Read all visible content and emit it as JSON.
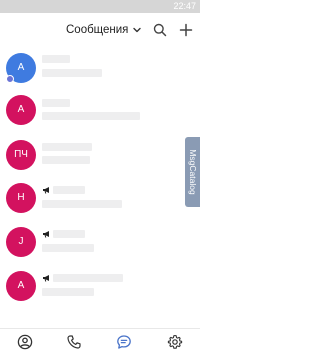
{
  "status_bar": {
    "time": "22:47"
  },
  "header": {
    "title": "Сообщения",
    "icons": [
      "chevron-down-icon",
      "search-icon",
      "plus-icon"
    ]
  },
  "colors": {
    "avatar_blue": "#3f7be0",
    "avatar_magenta": "#d3125f",
    "online_dot": "#6b74d6",
    "side_tab": "#8a9bb4",
    "nav_active": "#4a74c9",
    "nav_inactive": "#333333"
  },
  "chats": [
    {
      "initials": "A",
      "color": "#3f7be0",
      "online": true,
      "channel": false
    },
    {
      "initials": "A",
      "color": "#d3125f",
      "online": false,
      "channel": false
    },
    {
      "initials": "ПЧ",
      "color": "#d3125f",
      "online": false,
      "channel": false
    },
    {
      "initials": "H",
      "color": "#d3125f",
      "online": false,
      "channel": true
    },
    {
      "initials": "J",
      "color": "#d3125f",
      "online": false,
      "channel": true
    },
    {
      "initials": "A",
      "color": "#d3125f",
      "online": false,
      "channel": true
    }
  ],
  "side_tab": {
    "label": "MsgCatalog"
  },
  "bottom_nav": {
    "items": [
      {
        "icon": "profile-icon",
        "active": false
      },
      {
        "icon": "phone-icon",
        "active": false
      },
      {
        "icon": "chat-bubble-icon",
        "active": true
      },
      {
        "icon": "gear-icon",
        "active": false
      }
    ]
  }
}
